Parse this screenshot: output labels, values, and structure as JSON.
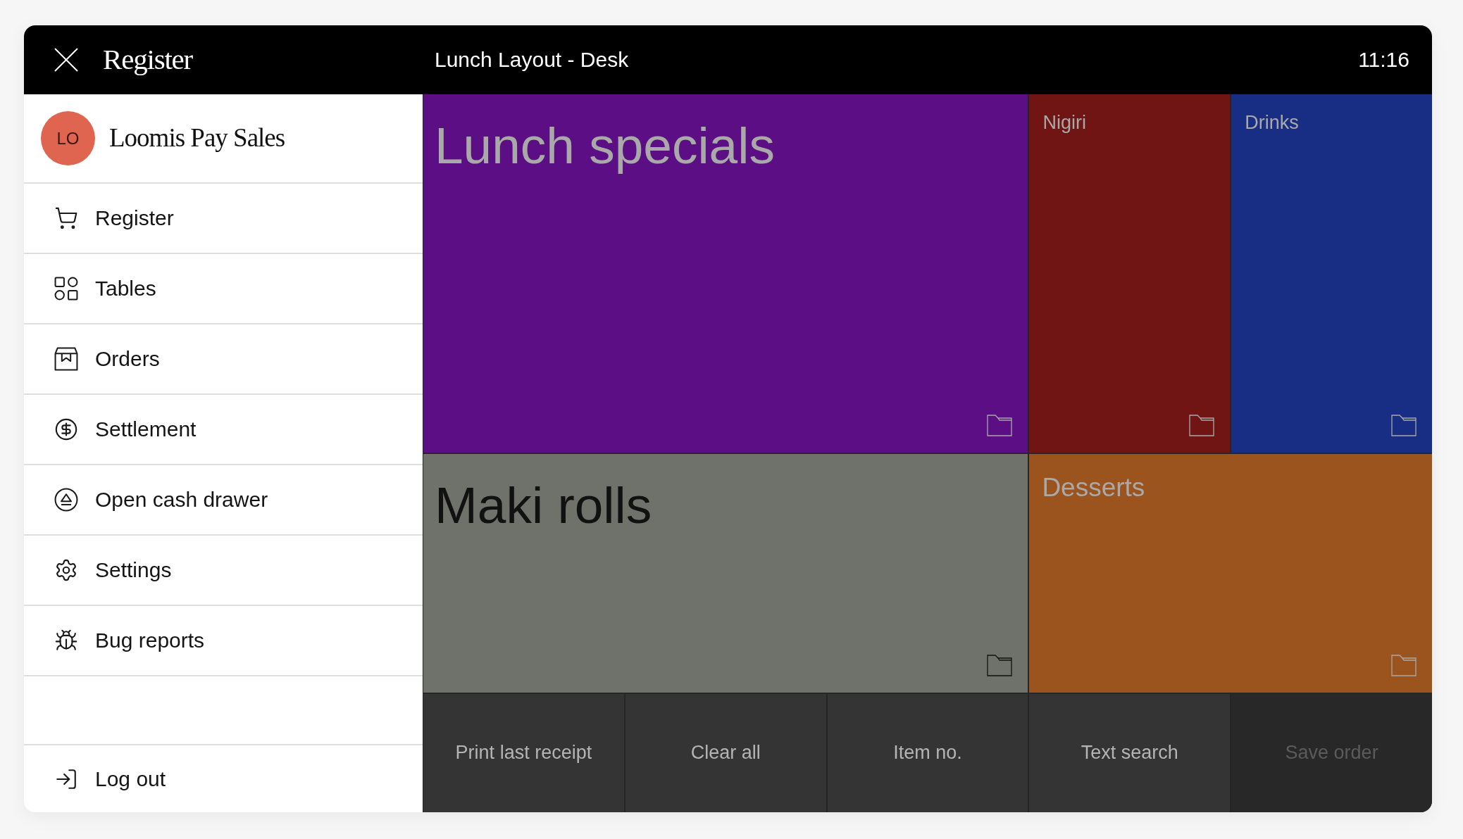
{
  "top_bar": {
    "title": "Register",
    "layout_name": "Lunch Layout - Desk",
    "time": "11:16"
  },
  "sidebar": {
    "account": {
      "initials": "LO",
      "name": "Loomis Pay Sales"
    },
    "items": [
      {
        "label": "Register"
      },
      {
        "label": "Tables"
      },
      {
        "label": "Orders"
      },
      {
        "label": "Settlement"
      },
      {
        "label": "Open cash drawer"
      },
      {
        "label": "Settings"
      },
      {
        "label": "Bug reports"
      }
    ],
    "footer_items": [
      {
        "label": "Log out"
      }
    ]
  },
  "tiles": [
    {
      "label": "Lunch specials",
      "color": "#5c0f84"
    },
    {
      "label": "Nigiri",
      "color": "#701414"
    },
    {
      "label": "Drinks",
      "color": "#182e85"
    },
    {
      "label": "Maki rolls",
      "color": "#6f726b"
    },
    {
      "label": "Desserts",
      "color": "#9c541e"
    }
  ],
  "actions": [
    {
      "label": "Print last receipt",
      "disabled": false
    },
    {
      "label": "Clear all",
      "disabled": false
    },
    {
      "label": "Item no.",
      "disabled": false
    },
    {
      "label": "Text search",
      "disabled": false
    },
    {
      "label": "Save order",
      "disabled": true
    }
  ]
}
